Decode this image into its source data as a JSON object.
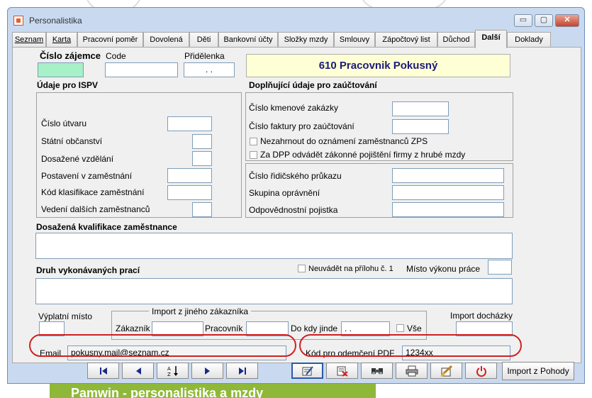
{
  "window": {
    "title": "Personalistika"
  },
  "background": {
    "banner_text": "Pamwin - personalistika a mzdy"
  },
  "tabs": [
    {
      "label": "Seznam"
    },
    {
      "label": "Karta"
    },
    {
      "label": "Pracovní poměr"
    },
    {
      "label": "Dovolená"
    },
    {
      "label": "Děti"
    },
    {
      "label": "Bankovní účty"
    },
    {
      "label": "Složky mzdy"
    },
    {
      "label": "Smlouvy"
    },
    {
      "label": "Zápočtový list"
    },
    {
      "label": "Důchod"
    },
    {
      "label": "Další"
    },
    {
      "label": "Doklady"
    }
  ],
  "active_tab": "Další",
  "header": {
    "cislo_zajemce_label": "Číslo zájemce",
    "code_label": "Code",
    "pridelenka_label": "Přidělenka",
    "pridelenka_value": ". .",
    "employee_name": "610 Pracovnik Pokusný"
  },
  "ispv": {
    "title": "Údaje pro ISPV",
    "fields": [
      {
        "label": "Číslo útvaru"
      },
      {
        "label": "Státní občanství"
      },
      {
        "label": "Dosažené vzdělání"
      },
      {
        "label": "Postavení v zaměstnání"
      },
      {
        "label": "Kód klasifikace zaměstnání"
      },
      {
        "label": "Vedení dalších zaměstnanců"
      }
    ]
  },
  "zauctovani": {
    "title": "Doplňující údaje pro zaúčtování",
    "kmenove_zakazky": "Číslo kmenové zakázky",
    "faktury": "Číslo faktury pro zaúčtování",
    "nezahrnout": "Nezahrnout do oznámení zaměstnanců ZPS",
    "dpp": "Za DPP odvádět zákonné pojištění firmy z hrubé mzdy"
  },
  "ridic": {
    "prukaz": "Číslo řidičského průkazu",
    "skupina": "Skupina oprávnění",
    "pojistka": "Odpovědnostní pojistka"
  },
  "kvalifikace_label": "Dosažená kvalifikace zaměstnance",
  "druh_prace_label": "Druh vykonávaných prací",
  "neuvadet_label": "Neuvádět na přílohu",
  "neuvadet_cislo": "č. 1",
  "misto_vykonu_label": "Místo výkonu práce",
  "vyplatni_misto_label": "Výplatní místo",
  "import_zakaznik": {
    "title": "Import z jiného zákazníka",
    "zakaznik": "Zákazník",
    "pracovnik": "Pracovník",
    "do_kdy": "Do kdy jinde",
    "do_kdy_value": ". .",
    "vse": "Vše"
  },
  "import_dochazky_label": "Import docházky",
  "email": {
    "label": "Email",
    "value": "pokusny.mail@seznam.cz"
  },
  "pdf": {
    "label": "Kód pro odemčení PDF",
    "value": "1234xx"
  },
  "toolbar": {
    "import_pohody_label": "Import z Pohody"
  },
  "colors": {
    "highlight_oval": "#d02020",
    "name_box": "#ffffd6",
    "green_field": "#a8f0c8"
  },
  "icons": [
    "first-record-icon",
    "previous-record-icon",
    "sort-icon",
    "next-record-icon",
    "last-record-icon",
    "edit-icon",
    "delete-icon",
    "search-icon",
    "print-icon",
    "clear-icon",
    "power-icon"
  ]
}
